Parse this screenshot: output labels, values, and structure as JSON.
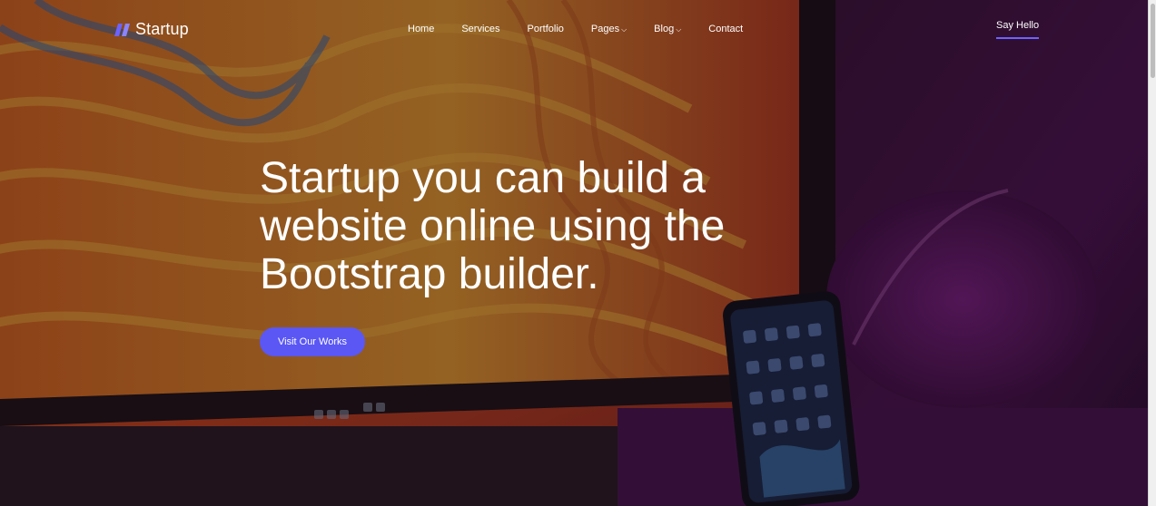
{
  "brand": {
    "name": "Startup",
    "logo_icon": "double-slash-logo-icon",
    "accent_color": "#5a57f5"
  },
  "nav": {
    "items": [
      {
        "label": "Home",
        "has_dropdown": false
      },
      {
        "label": "Services",
        "has_dropdown": false
      },
      {
        "label": "Portfolio",
        "has_dropdown": false
      },
      {
        "label": "Pages",
        "has_dropdown": true
      },
      {
        "label": "Blog",
        "has_dropdown": true
      },
      {
        "label": "Contact",
        "has_dropdown": false
      }
    ],
    "dropdown_icon": "chevron-down-icon"
  },
  "header_cta": {
    "label": "Say Hello",
    "underline_color": "#6c63ff"
  },
  "hero": {
    "headline": "Startup you can build a website online using the Bootstrap builder.",
    "button_label": "Visit Our Works",
    "background": "photo of desk with monitor showing colorful wave art and smartphone, purple lighting"
  }
}
